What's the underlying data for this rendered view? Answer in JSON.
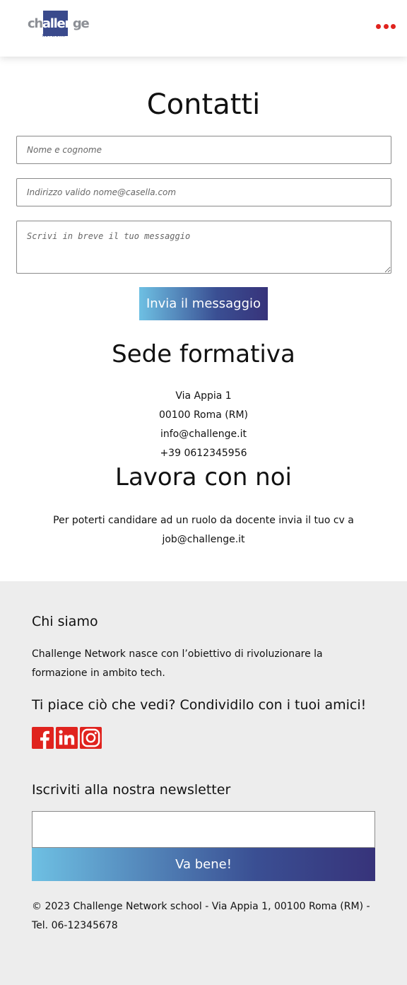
{
  "header": {
    "logo_text_a": "ch",
    "logo_text_b": "allen",
    "logo_text_c": "ge",
    "logo_sub": "NETWORK",
    "brand_color": "#3a4a8c",
    "menu_icon": "more-dots-icon",
    "menu_color": "#e0231e"
  },
  "contact": {
    "title": "Contatti",
    "name_placeholder": "Nome e cognome",
    "email_placeholder": "Indirizzo valido nome@casella.com",
    "message_placeholder": "Scrivi in breve il tuo messaggio",
    "submit_label": "Invia il messaggio"
  },
  "sede": {
    "title": "Sede formativa",
    "street": "Via Appia 1",
    "city": "00100 Roma (RM)",
    "email": "info@challenge.it",
    "phone": "+39 0612345956"
  },
  "lavora": {
    "title": "Lavora con noi",
    "text": "Per poterti candidare ad un ruolo da docente invia il tuo cv a",
    "email": "job@challenge.it"
  },
  "footer": {
    "about_title": "Chi siamo",
    "about_text": "Challenge Network nasce con l’obiettivo di rivoluzionare la formazione in ambito tech.",
    "share_title": "Ti piace ciò che vedi? Condividilo con i tuoi amici!",
    "social": [
      "facebook-icon",
      "linkedin-icon",
      "instagram-icon"
    ],
    "social_color": "#e0231e",
    "newsletter_title": "Iscriviti alla nostra newsletter",
    "newsletter_value": "",
    "newsletter_button": "Va bene!",
    "copyright": "© 2023 Challenge Network school - Via Appia 1, 00100 Roma (RM) - Tel. 06-12345678"
  }
}
